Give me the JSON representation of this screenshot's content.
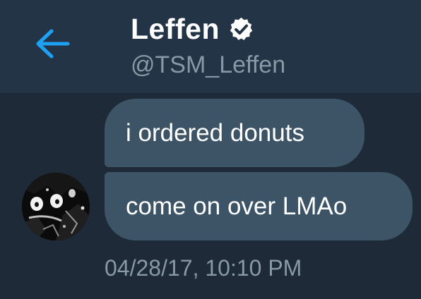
{
  "colors": {
    "background": "#1e2a38",
    "header_background": "#243447",
    "bubble": "#3d5466",
    "accent": "#1da1f2",
    "secondary_text": "#8899a6"
  },
  "header": {
    "back_icon": "arrow-left-icon",
    "display_name": "Leffen",
    "verified_icon": "verified-badge-icon",
    "handle": "@TSM_Leffen"
  },
  "messages": [
    {
      "text": "i ordered donuts"
    },
    {
      "text": "come on over LMAo"
    }
  ],
  "avatar_icon": "user-avatar",
  "timestamp": "04/28/17, 10:10 PM"
}
